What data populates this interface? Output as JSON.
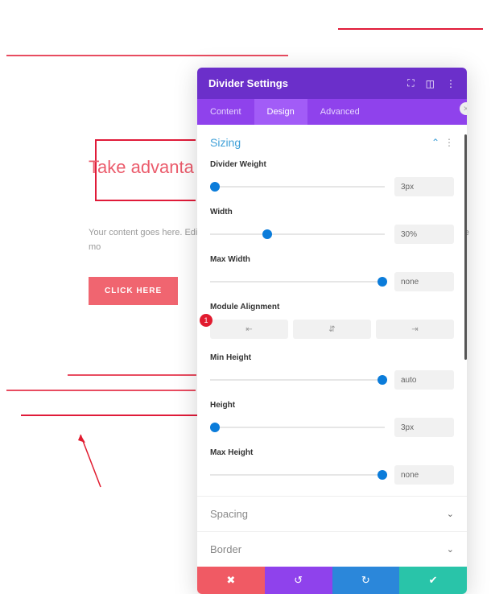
{
  "page": {
    "headline": "Take advanta",
    "body": "Your content goes here. Edit or r                                                                       can also style every aspect of this                                                                     custom CSS to this text in the mo",
    "cta_label": "CLICK HERE"
  },
  "panel": {
    "title": "Divider Settings",
    "tabs": {
      "content": "Content",
      "design": "Design",
      "advanced": "Advanced"
    },
    "section_sizing": "Sizing",
    "fields": {
      "divider_weight": {
        "label": "Divider Weight",
        "value": "3px"
      },
      "width": {
        "label": "Width",
        "value": "30%"
      },
      "max_width": {
        "label": "Max Width",
        "value": "none"
      },
      "module_alignment": {
        "label": "Module Alignment"
      },
      "min_height": {
        "label": "Min Height",
        "value": "auto"
      },
      "height": {
        "label": "Height",
        "value": "3px"
      },
      "max_height": {
        "label": "Max Height",
        "value": "none"
      }
    },
    "step_badge": "1",
    "section_spacing": "Spacing",
    "section_border": "Border"
  },
  "align_icons": {
    "left": "⇤",
    "center": "⇵",
    "right": "⇥"
  }
}
